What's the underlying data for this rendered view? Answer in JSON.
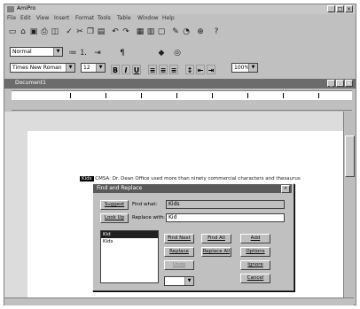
{
  "window": {
    "title": "AmiPro"
  },
  "menu": [
    "File",
    "Edit",
    "View",
    "Insert",
    "Format",
    "Tools",
    "Table",
    "Window",
    "Help"
  ],
  "toolbar": {
    "icons": [
      "new-icon",
      "open-icon",
      "save-icon",
      "print-icon",
      "preview-icon",
      "spell-icon",
      "cut-icon",
      "copy-icon",
      "paste-icon",
      "undo-icon",
      "redo-icon",
      "table-icon",
      "columns-icon",
      "frame-icon",
      "draw-icon",
      "chart-icon",
      "zoom-icon",
      "help-icon"
    ]
  },
  "format_bar": {
    "style": "Normal",
    "font": "Times New Roman",
    "size": "12",
    "bold": "B",
    "italic": "I",
    "underline": "U",
    "zoom": "100%"
  },
  "document": {
    "title": "Document1",
    "text_highlighted": "Kids",
    "text_rest": "CMSA: Dr. Dean Office used more than ninety commercial characters and thesaurus"
  },
  "dialog": {
    "title": "Find and Replace",
    "find_label": "Find what:",
    "find_value": "Kids",
    "replace_label": "Replace with:",
    "replace_value": "Kid",
    "suggest_button": "Suggest",
    "lookup_button": "Look Up",
    "list_items": [
      "Kid",
      "Kids"
    ],
    "selected_index": 0,
    "buttons": {
      "find_next": "Find Next",
      "find_all": "Find All",
      "replace": "Replace",
      "replace_all": "Replace All",
      "add": "Add",
      "options": "Options",
      "undo": "Undo",
      "ignore": "Ignore",
      "close": "Close",
      "help": "Help",
      "cancel": "Cancel"
    }
  }
}
